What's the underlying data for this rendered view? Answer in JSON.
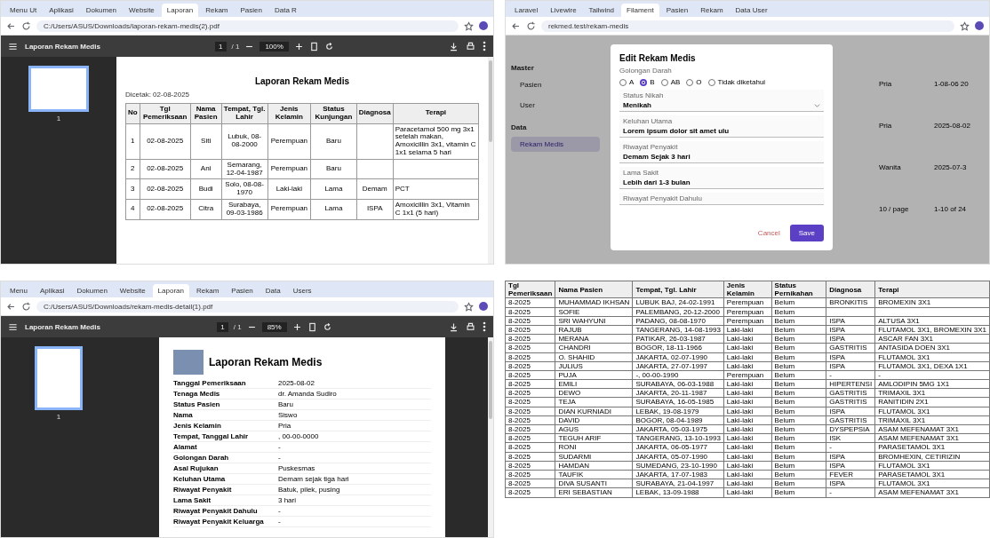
{
  "pdf_table_view": {
    "browser": {
      "tabs": [
        {
          "label": "Menu Ut",
          "selected": false
        },
        {
          "label": "Aplikasi",
          "selected": false
        },
        {
          "label": "Dokumen",
          "selected": false
        },
        {
          "label": "Website",
          "selected": false
        },
        {
          "label": "Laporan",
          "selected": true
        },
        {
          "label": "Rekam",
          "selected": false
        },
        {
          "label": "Pasien",
          "selected": false
        },
        {
          "label": "Data R",
          "selected": false
        }
      ],
      "url": "C:/Users/ASUS/Downloads/laporan-rekam-medis(2).pdf"
    },
    "toolbar": {
      "title": "Laporan Rekam Medis",
      "page": "1",
      "pages": "/ 1",
      "zoom": "100%"
    },
    "thumbnail_page": "1",
    "document": {
      "title": "Laporan Rekam Medis",
      "subtitle": "Dicetak: 02-08-2025",
      "columns": [
        "No",
        "Tgl Pemeriksaan",
        "Nama Pasien",
        "Tempat, Tgl. Lahir",
        "Jenis Kelamin",
        "Status Kunjungan",
        "Diagnosa",
        "Terapi"
      ],
      "rows": [
        [
          "1",
          "02-08-2025",
          "Siti",
          "Lubuk, 08-08-2000",
          "Perempuan",
          "Baru",
          "",
          "Paracetamol 500 mg 3x1 setelah makan, Amoxicillin 3x1, vitamin C 1x1 selama 5 hari"
        ],
        [
          "2",
          "02-08-2025",
          "Ani",
          "Semarang, 12-04-1987",
          "Perempuan",
          "Baru",
          "",
          ""
        ],
        [
          "3",
          "02-08-2025",
          "Budi",
          "Solo, 08-08-1970",
          "Laki-laki",
          "Lama",
          "Demam",
          "PCT"
        ],
        [
          "4",
          "02-08-2025",
          "Citra",
          "Surabaya, 09-03-1986",
          "Perempuan",
          "Lama",
          "ISPA",
          "Amoxicillin 3x1, Vitamin C 1x1 (5 hari)"
        ]
      ]
    }
  },
  "edit_dialog_view": {
    "browser": {
      "tabs": [
        {
          "label": "Laravel",
          "selected": false
        },
        {
          "label": "Livewire",
          "selected": false
        },
        {
          "label": "Tailwind",
          "selected": false
        },
        {
          "label": "Filament",
          "selected": true
        },
        {
          "label": "Pasien",
          "selected": false
        },
        {
          "label": "Rekam",
          "selected": false
        },
        {
          "label": "Data User",
          "selected": false
        }
      ],
      "url": "rekmed.test/rekam-medis"
    },
    "sidebar": [
      {
        "heading": "Master",
        "items": [
          {
            "label": "Pasien",
            "selected": false
          },
          {
            "label": "User",
            "selected": false
          }
        ]
      },
      {
        "heading": "Data",
        "items": [
          {
            "label": "Rekam Medis",
            "selected": true
          }
        ]
      }
    ],
    "background_cells": [
      "Pria",
      "1-08-06 20",
      "Pria",
      "2025-08-02",
      "Wanita",
      "2025-07-3",
      "10 / page",
      "1-10 of 24"
    ],
    "dialog": {
      "title": "Edit Rekam Medis",
      "radio_group": {
        "label": "Golongan Darah",
        "options": [
          {
            "label": "A",
            "selected": false
          },
          {
            "label": "B",
            "selected": true
          },
          {
            "label": "AB",
            "selected": false
          },
          {
            "label": "O",
            "selected": false
          },
          {
            "label": "Tidak diketahui",
            "selected": false
          }
        ]
      },
      "fields": [
        {
          "kind": "select",
          "label": "Status Nikah",
          "value": "Menikah"
        },
        {
          "kind": "text",
          "label": "Keluhan Utama",
          "value": "Lorem ipsum dolor sit amet ulu"
        },
        {
          "kind": "text",
          "label": "Riwayat Penyakit",
          "value": "Demam Sejak 3 hari"
        },
        {
          "kind": "text",
          "label": "Lama Sakit",
          "value": "Lebih dari 1-3 bulan"
        },
        {
          "kind": "text",
          "label": "Riwayat Penyakit Dahulu"
        }
      ],
      "buttons": [
        {
          "kind": "cancel",
          "label": "Cancel"
        },
        {
          "kind": "save",
          "label": "Save"
        }
      ]
    }
  },
  "pdf_detail_view": {
    "browser": {
      "tabs": [
        {
          "label": "Menu",
          "selected": false
        },
        {
          "label": "Aplikasi",
          "selected": false
        },
        {
          "label": "Dokumen",
          "selected": false
        },
        {
          "label": "Website",
          "selected": false
        },
        {
          "label": "Laporan",
          "selected": true
        },
        {
          "label": "Rekam",
          "selected": false
        },
        {
          "label": "Pasien",
          "selected": false
        },
        {
          "label": "Data",
          "selected": false
        },
        {
          "label": "Users",
          "selected": false
        }
      ],
      "url": "C:/Users/ASUS/Downloads/rekam-medis-detail(1).pdf"
    },
    "toolbar": {
      "title": "Laporan Rekam Medis",
      "page": "1",
      "pages": "/ 1",
      "zoom": "85%"
    },
    "thumbnail_page": "1",
    "document": {
      "title": "Laporan Rekam Medis",
      "details": [
        {
          "label": "Tanggal Pemeriksaan",
          "value": "2025-08-02"
        },
        {
          "label": "Tenaga Medis",
          "value": "dr. Amanda Sudiro"
        },
        {
          "label": "Status Pasien",
          "value": "Baru"
        },
        {
          "label": "Nama",
          "value": "Siswo"
        },
        {
          "label": "Jenis Kelamin",
          "value": "Pria"
        },
        {
          "label": "Tempat, Tanggal Lahir",
          "value": ", 00-00-0000"
        },
        {
          "label": "Alamat",
          "value": "-"
        },
        {
          "label": "Golongan Darah",
          "value": "-"
        },
        {
          "label": "Asal Rujukan",
          "value": "Puskesmas"
        },
        {
          "label": "Keluhan Utama",
          "value": "Demam sejak tiga hari"
        },
        {
          "label": "Riwayat Penyakit",
          "value": "Batuk, pilek, pusing"
        },
        {
          "label": "Lama Sakit",
          "value": "3 hari"
        },
        {
          "label": "Riwayat Penyakit Dahulu",
          "value": "-"
        },
        {
          "label": "Riwayat Penyakit Keluarga",
          "value": "-"
        }
      ]
    }
  },
  "patient_table": {
    "columns": [
      "Tgl Pemeriksaan",
      "Nama Pasien",
      "Tempat, Tgl. Lahir",
      "Jenis Kelamin",
      "Status Pernikahan",
      "Diagnosa",
      "Terapi"
    ],
    "rows": [
      [
        "8-2025",
        "MUHAMMAD IKHSAN",
        "LUBUK BAJ, 24-02-1991",
        "Perempuan",
        "Belum",
        "BRONKITIS",
        "BROMEXIN 3X1"
      ],
      [
        "8-2025",
        "SOFIE",
        "PALEMBANG, 20-12-2000",
        "Perempuan",
        "Belum",
        "",
        ""
      ],
      [
        "8-2025",
        "SRI WAHYUNI",
        "PADANG, 08-08-1970",
        "Perempuan",
        "Belum",
        "ISPA",
        "ALTUSA 3X1"
      ],
      [
        "8-2025",
        "RAJUB",
        "TANGERANG, 14-08-1993",
        "Laki-laki",
        "Belum",
        "ISPA",
        "FLUTAMOL 3X1, BROMEXIN 3X1"
      ],
      [
        "8-2025",
        "MERANA",
        "PATIKAR, 26-03-1987",
        "Laki-laki",
        "Belum",
        "ISPA",
        "ASCAR FAN 3X1"
      ],
      [
        "8-2025",
        "CHANDRI",
        "BOGOR, 18-11-1966",
        "Laki-laki",
        "Belum",
        "GASTRITIS",
        "ANTASIDA DOEN 3X1"
      ],
      [
        "8-2025",
        "O. SHAHID",
        "JAKARTA, 02-07-1990",
        "Laki-laki",
        "Belum",
        "ISPA",
        "FLUTAMOL 3X1"
      ],
      [
        "8-2025",
        "JULIUS",
        "JAKARTA, 27-07-1997",
        "Laki-laki",
        "Belum",
        "ISPA",
        "FLUTAMOL 3X1, DEXA 1X1"
      ],
      [
        "8-2025",
        "PUJA",
        "-, 00-00-1990",
        "Perempuan",
        "Belum",
        "-",
        "-"
      ],
      [
        "8-2025",
        "EMILI",
        "SURABAYA, 06-03-1988",
        "Laki-laki",
        "Belum",
        "HIPERTENSI",
        "AMLODIPIN 5MG 1X1"
      ],
      [
        "8-2025",
        "DEWO",
        "JAKARTA, 20-11-1987",
        "Laki-laki",
        "Belum",
        "GASTRITIS",
        "TRIMAXIL 3X1"
      ],
      [
        "8-2025",
        "TEJA",
        "SURABAYA, 16-05-1985",
        "Laki-laki",
        "Belum",
        "GASTRITIS",
        "RANITIDIN 2X1"
      ],
      [
        "8-2025",
        "DIAN KURNIADI",
        "LEBAK, 19-08-1979",
        "Laki-laki",
        "Belum",
        "ISPA",
        "FLUTAMOL 3X1"
      ],
      [
        "8-2025",
        "DAVID",
        "BOGOR, 08-04-1989",
        "Laki-laki",
        "Belum",
        "GASTRITIS",
        "TRIMAXIL 3X1"
      ],
      [
        "8-2025",
        "AGUS",
        "JAKARTA, 05-03-1975",
        "Laki-laki",
        "Belum",
        "DYSPEPSIA",
        "ASAM MEFENAMAT 3X1"
      ],
      [
        "8-2025",
        "TEGUH ARIF",
        "TANGERANG, 13-10-1993",
        "Laki-laki",
        "Belum",
        "ISK",
        "ASAM MEFENAMAT 3X1"
      ],
      [
        "8-2025",
        "RONI",
        "JAKARTA, 06-05-1977",
        "Laki-laki",
        "Belum",
        "-",
        "PARASETAMOL 3X1"
      ],
      [
        "8-2025",
        "SUDARMI",
        "JAKARTA, 05-07-1990",
        "Laki-laki",
        "Belum",
        "ISPA",
        "BROMHEXIN, CETIRIZIN"
      ],
      [
        "8-2025",
        "HAMDAN",
        "SUMEDANG, 23-10-1990",
        "Laki-laki",
        "Belum",
        "ISPA",
        "FLUTAMOL 3X1"
      ],
      [
        "8-2025",
        "TAUFIK",
        "JAKARTA, 17-07-1983",
        "Laki-laki",
        "Belum",
        "FEVER",
        "PARASETAMOL 3X1"
      ],
      [
        "8-2025",
        "DIVA SUSANTI",
        "SURABAYA, 21-04-1997",
        "Laki-laki",
        "Belum",
        "ISPA",
        "FLUTAMOL 3X1"
      ],
      [
        "8-2025",
        "ERI SEBASTIAN",
        "LEBAK, 13-09-1988",
        "Laki-laki",
        "Belum",
        "-",
        "ASAM MEFENAMAT 3X1"
      ]
    ]
  }
}
